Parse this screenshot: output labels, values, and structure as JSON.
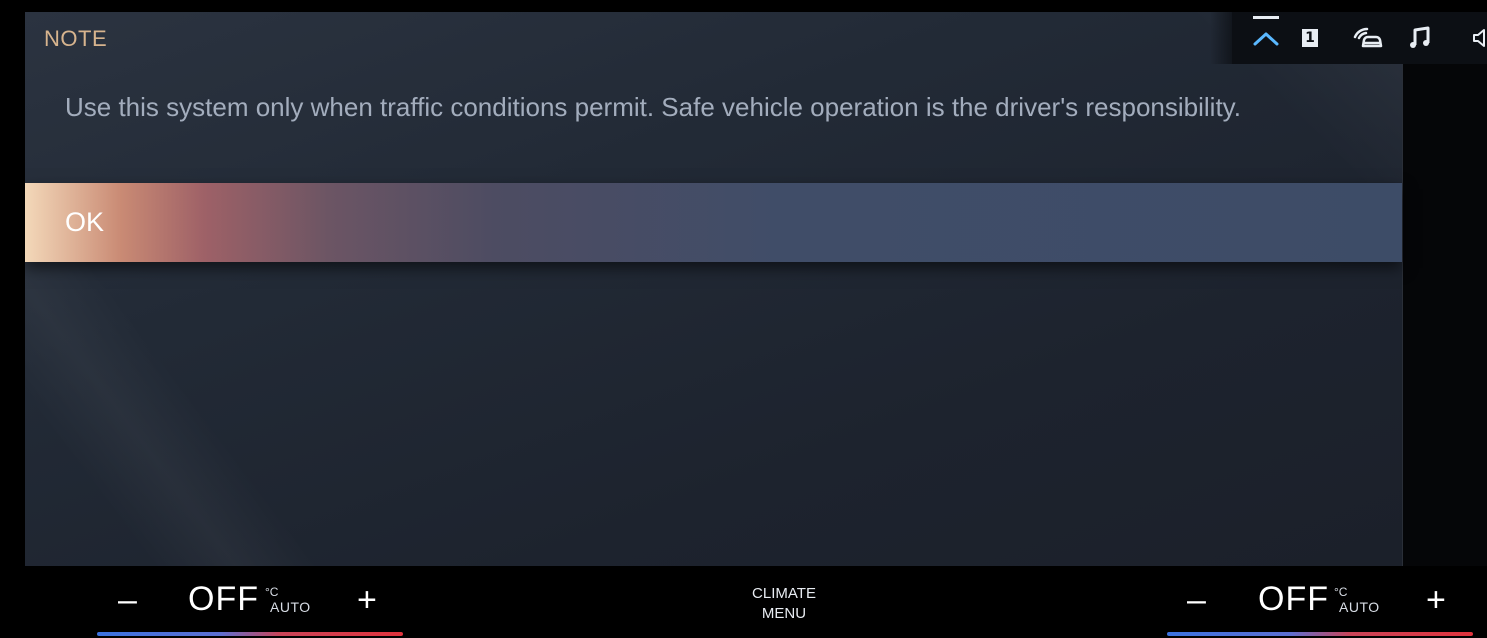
{
  "dialog": {
    "title": "NOTE",
    "message": "Use this system only when traffic conditions permit. Safe vehicle operation is the driver's responsibility.",
    "ok_label": "OK"
  },
  "status_bar": {
    "icons": [
      "chevron-up-icon",
      "one-icon",
      "car-connection-icon",
      "music-icon",
      "speaker-icon"
    ],
    "one_label": "1",
    "accent_color": "#5ab8ff"
  },
  "climate": {
    "left": {
      "minus": "–",
      "value": "OFF",
      "unit": "°C",
      "mode": "AUTO",
      "plus": "+"
    },
    "right": {
      "minus": "–",
      "value": "OFF",
      "unit": "°C",
      "mode": "AUTO",
      "plus": "+"
    },
    "menu_line1": "CLIMATE",
    "menu_line2": "MENU"
  },
  "colors": {
    "title": "#d7b48e",
    "message": "#a3adbd",
    "highlight_start": "#f3d8b9",
    "highlight_end": "#3d4c67",
    "temp_cold": "#3b72e0",
    "temp_hot": "#e0333d"
  }
}
